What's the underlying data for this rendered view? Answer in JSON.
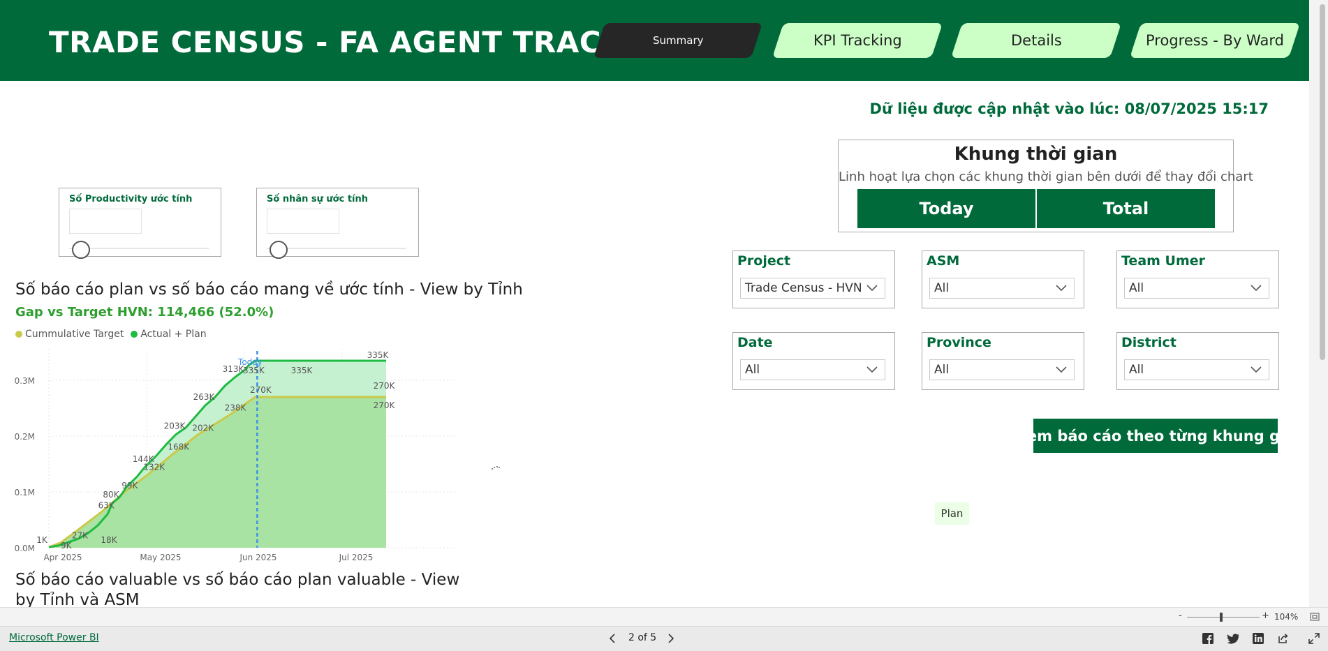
{
  "header": {
    "title": "TRADE CENSUS - FA AGENT TRACKING",
    "tabs": [
      {
        "label": "Summary",
        "active": true
      },
      {
        "label": "KPI Tracking",
        "active": false
      },
      {
        "label": "Details",
        "active": false
      },
      {
        "label": "Progress - By Ward",
        "active": false
      }
    ]
  },
  "updated_text": "Dữ liệu được cập nhật vào lúc: 08/07/2025 15:17",
  "parameters": [
    {
      "label": "Số Productivity ước tính",
      "value": ""
    },
    {
      "label": "Số nhân sự ước tính",
      "value": ""
    }
  ],
  "chart_section": {
    "title": "Số báo cáo plan vs số báo cáo mang về ước tính - View by Tỉnh",
    "gap_text": "Gap vs Target HVN: 114,466 (52.0%)",
    "legend": [
      {
        "label": "Cummulative Target",
        "color": "#c9c94a"
      },
      {
        "label": "Actual + Plan",
        "color": "#1fba42"
      }
    ]
  },
  "chart_data": {
    "type": "area",
    "x_ticks": [
      "Apr 2025",
      "May 2025",
      "Jun 2025",
      "Jul 2025"
    ],
    "y_ticks": [
      "0.0M",
      "0.1M",
      "0.2M",
      "0.3M"
    ],
    "ylim": [
      0,
      0.35
    ],
    "today_label": "Today",
    "grid": true,
    "legend_position": "top-left",
    "series": [
      {
        "name": "Cummulative Target",
        "color": "#c9c94a",
        "fill": "#a8e1a0",
        "points": [
          [
            0,
            0.001
          ],
          [
            0.12,
            0.009
          ],
          [
            0.26,
            0.027
          ],
          [
            0.53,
            0.063
          ],
          [
            0.77,
            0.099
          ],
          [
            1.02,
            0.132
          ],
          [
            1.27,
            0.168
          ],
          [
            1.52,
            0.202
          ],
          [
            1.85,
            0.238
          ],
          [
            2.11,
            0.27
          ],
          [
            2.11,
            0.27
          ]
        ],
        "labels": [
          {
            "i": 1,
            "text": "9K"
          },
          {
            "i": 2,
            "text": "27K"
          },
          {
            "i": 3,
            "text": "63K"
          },
          {
            "i": 4,
            "text": "99K"
          },
          {
            "i": 5,
            "text": "132K"
          },
          {
            "i": 6,
            "text": "168K"
          },
          {
            "i": 7,
            "text": "202K"
          },
          {
            "i": 8,
            "text": "238K"
          },
          {
            "i": 9,
            "text": "270K"
          }
        ]
      },
      {
        "name": "Actual + Plan",
        "color": "#1fba42",
        "fill": "#bff0cc",
        "points": [
          [
            0,
            0.001
          ],
          [
            0.1,
            0.004
          ],
          [
            0.2,
            0.01
          ],
          [
            0.3,
            0.016
          ],
          [
            0.4,
            0.026
          ],
          [
            0.5,
            0.04
          ],
          [
            0.6,
            0.06
          ],
          [
            0.65,
            0.08
          ],
          [
            0.72,
            0.09
          ],
          [
            0.8,
            0.11
          ],
          [
            0.9,
            0.127
          ],
          [
            0.98,
            0.144
          ],
          [
            1.1,
            0.165
          ],
          [
            1.2,
            0.185
          ],
          [
            1.3,
            0.203
          ],
          [
            1.4,
            0.215
          ],
          [
            1.5,
            0.235
          ],
          [
            1.6,
            0.255
          ],
          [
            1.7,
            0.27
          ],
          [
            1.8,
            0.29
          ],
          [
            1.9,
            0.305
          ],
          [
            2.0,
            0.318
          ],
          [
            2.05,
            0.328
          ],
          [
            2.11,
            0.335
          ],
          [
            2.55,
            0.335
          ],
          [
            3.45,
            0.335
          ]
        ],
        "labels": [
          {
            "i": 0,
            "text": "1K"
          },
          {
            "i": 4,
            "text": "18K"
          },
          {
            "i": 7,
            "text": "80K"
          },
          {
            "i": 11,
            "text": "144K"
          },
          {
            "i": 14,
            "text": "203K"
          },
          {
            "i": 17,
            "text": "263K"
          },
          {
            "i": 20,
            "text": "313K"
          },
          {
            "i": 23,
            "text": "335K"
          },
          {
            "i": 24,
            "text": "335K"
          },
          {
            "i": 25,
            "text": "335K"
          }
        ]
      }
    ],
    "end_labels": [
      "270K",
      "270K"
    ]
  },
  "chart2_title": "Số báo cáo valuable vs số báo cáo plan valuable - View by Tỉnh và ASM",
  "time_window": {
    "title": "Khung thời gian",
    "subtitle": "Linh hoạt lựa chọn các khung thời gian bên dưới để thay đổi chart",
    "buttons": [
      "Today",
      "Total"
    ]
  },
  "slicers": [
    {
      "label": "Project",
      "value": "Trade Census - HVN"
    },
    {
      "label": "ASM",
      "value": "All"
    },
    {
      "label": "Team Umer",
      "value": "All"
    },
    {
      "label": "Date",
      "value": "All"
    },
    {
      "label": "Province",
      "value": "All"
    },
    {
      "label": "District",
      "value": "All"
    }
  ],
  "report_button": "Xem báo cáo theo từng khung giờ",
  "plan_chip": "Plan",
  "footer": {
    "brand_link": "Microsoft Power BI",
    "page_indicator": "2 of 5",
    "zoom": {
      "minus": "-",
      "plus": "+",
      "value": "104%",
      "level": 0.52
    },
    "icons": [
      "facebook-icon",
      "twitter-icon",
      "linkedin-icon",
      "share-icon",
      "fullscreen-icon"
    ]
  }
}
